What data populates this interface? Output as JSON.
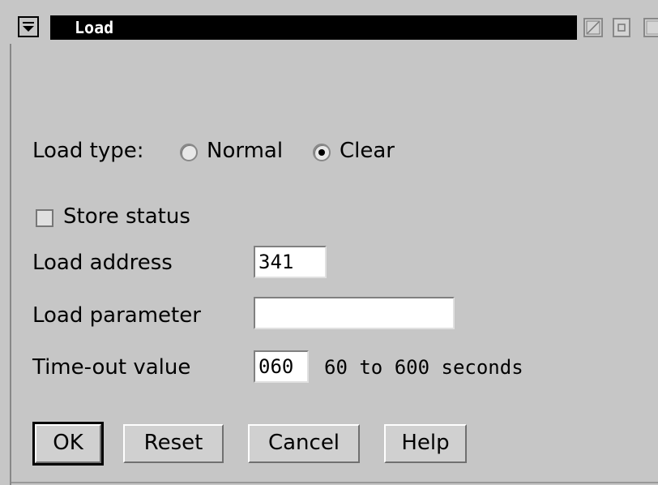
{
  "window": {
    "title": "Load"
  },
  "load_type": {
    "label": "Load type:",
    "options": [
      {
        "label": "Normal",
        "selected": false
      },
      {
        "label": "Clear",
        "selected": true
      }
    ]
  },
  "store_status": {
    "label": "Store status",
    "checked": false
  },
  "load_address": {
    "label": "Load address",
    "value": "341"
  },
  "load_parameter": {
    "label": "Load parameter",
    "value": ""
  },
  "timeout": {
    "label": "Time-out value",
    "value": "060",
    "hint": "60 to 600 seconds"
  },
  "buttons": {
    "ok": "OK",
    "reset": "Reset",
    "cancel": "Cancel",
    "help": "Help"
  },
  "icons": {
    "system_menu": "chevron-down-icon",
    "restore": "restore-icon",
    "minimize": "minimize-icon",
    "maximize": "maximize-icon"
  }
}
